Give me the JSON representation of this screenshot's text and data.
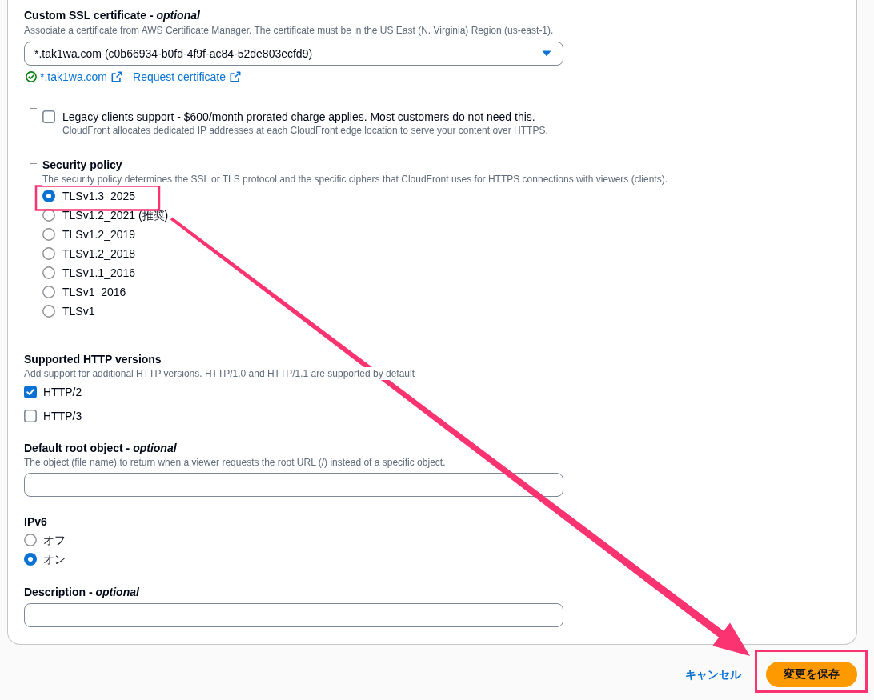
{
  "certificate": {
    "label": "Custom SSL certificate - *optional*",
    "description": "Associate a certificate from AWS Certificate Manager. The certificate must be in the US East (N. Virginia) Region (us-east-1).",
    "value": "*.tak1wa.com (c0b66934-b0fd-4f9f-ac84-52de803ecfd9)",
    "links": [
      {
        "label": "*.tak1wa.com",
        "kind": "status"
      },
      {
        "label": "Request certificate",
        "kind": "plain"
      }
    ]
  },
  "legacy_clients": {
    "label": "Legacy clients support - $600/month prorated charge applies. Most customers do not need this.",
    "description": "CloudFront allocates dedicated IP addresses at each CloudFront edge location to serve your content over HTTPS.",
    "checked": false
  },
  "security_policy": {
    "label": "Security policy",
    "description": "The security policy determines the SSL or TLS protocol and the specific ciphers that CloudFront uses for HTTPS connections with viewers (clients).",
    "options": [
      {
        "label": "TLSv1.3_2025",
        "selected": true
      },
      {
        "label": "TLSv1.2_2021 (推奨)",
        "selected": false
      },
      {
        "label": "TLSv1.2_2019",
        "selected": false
      },
      {
        "label": "TLSv1.2_2018",
        "selected": false
      },
      {
        "label": "TLSv1.1_2016",
        "selected": false
      },
      {
        "label": "TLSv1_2016",
        "selected": false
      },
      {
        "label": "TLSv1",
        "selected": false
      }
    ]
  },
  "http_versions": {
    "label": "Supported HTTP versions",
    "description": "Add support for additional HTTP versions. HTTP/1.0 and HTTP/1.1 are supported by default",
    "options": [
      {
        "label": "HTTP/2",
        "checked": true
      },
      {
        "label": "HTTP/3",
        "checked": false
      }
    ]
  },
  "default_root_object": {
    "label": "Default root object - *optional*",
    "description": "The object (file name) to return when a viewer requests the root URL (/) instead of a specific object."
  },
  "ipv6": {
    "label": "IPv6",
    "options": [
      {
        "label": "オフ",
        "selected": false
      },
      {
        "label": "オン",
        "selected": true
      }
    ]
  },
  "description_field": {
    "label": "Description - *optional*"
  },
  "footer": {
    "cancel": "キャンセル",
    "save": "変更を保存"
  }
}
